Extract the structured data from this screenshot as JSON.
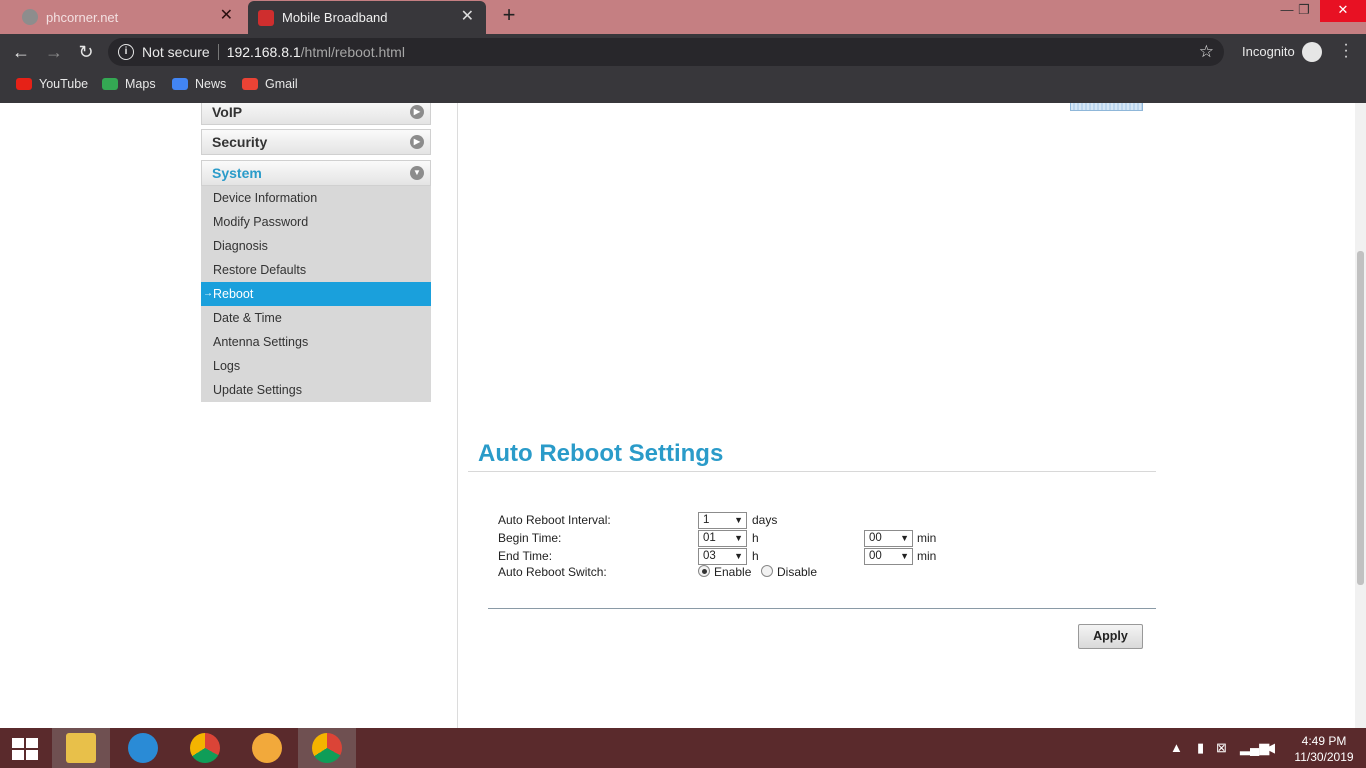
{
  "browser": {
    "tabs": [
      {
        "title": "phcorner.net",
        "active": false
      },
      {
        "title": "Mobile Broadband",
        "active": true
      }
    ],
    "new_tab_label": "+",
    "address": {
      "security": "Not secure",
      "host": "192.168.8.1",
      "path": "/html/reboot.html"
    },
    "profile_label": "Incognito",
    "bookmarks": [
      {
        "label": "YouTube",
        "color": "#e62117"
      },
      {
        "label": "Maps",
        "color": "#34a853"
      },
      {
        "label": "News",
        "color": "#4285f4"
      },
      {
        "label": "Gmail",
        "color": "#ea4335"
      }
    ]
  },
  "sidebar": {
    "sections": [
      {
        "label": "VoIP",
        "expanded": false
      },
      {
        "label": "Security",
        "expanded": false
      },
      {
        "label": "System",
        "expanded": true
      }
    ],
    "items": [
      {
        "label": "Device Information",
        "active": false
      },
      {
        "label": "Modify Password",
        "active": false
      },
      {
        "label": "Diagnosis",
        "active": false
      },
      {
        "label": "Restore Defaults",
        "active": false
      },
      {
        "label": "Reboot",
        "active": true
      },
      {
        "label": "Date & Time",
        "active": false
      },
      {
        "label": "Antenna Settings",
        "active": false
      },
      {
        "label": "Logs",
        "active": false
      },
      {
        "label": "Update Settings",
        "active": false
      }
    ]
  },
  "main": {
    "title": "Auto Reboot Settings",
    "interval_label": "Auto Reboot Interval:",
    "interval_value": "1",
    "interval_unit": "days",
    "begin_label": "Begin Time:",
    "begin_hour": "01",
    "begin_min": "00",
    "end_label": "End Time:",
    "end_hour": "03",
    "end_min": "00",
    "hour_unit": "h",
    "min_unit": "min",
    "switch_label": "Auto Reboot Switch:",
    "enable_label": "Enable",
    "disable_label": "Disable",
    "switch_value": "Enable",
    "apply_label": "Apply"
  },
  "taskbar": {
    "time": "4:49 PM",
    "date": "11/30/2019"
  },
  "colors": {
    "accent": "#2a9bc9",
    "active_item": "#1aa0dc",
    "tabbar": "#c57f82",
    "taskbar": "#5a2a2c"
  }
}
